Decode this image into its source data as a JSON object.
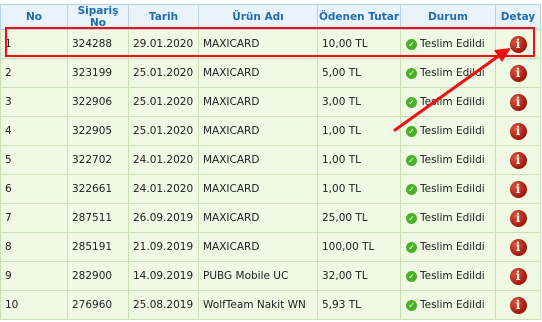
{
  "table": {
    "headers": [
      "No",
      "Sipariş No",
      "Tarih",
      "Ürün Adı",
      "Ödenen Tutar",
      "Durum",
      "Detay"
    ],
    "rows": [
      {
        "no": "1",
        "order": "324288",
        "date": "29.01.2020",
        "product": "MAXICARD",
        "amount": "10,00 TL",
        "status": "Teslim Edildi"
      },
      {
        "no": "2",
        "order": "323199",
        "date": "25.01.2020",
        "product": "MAXICARD",
        "amount": "5,00 TL",
        "status": "Teslim Edildi"
      },
      {
        "no": "3",
        "order": "322906",
        "date": "25.01.2020",
        "product": "MAXICARD",
        "amount": "3,00 TL",
        "status": "Teslim Edildi"
      },
      {
        "no": "4",
        "order": "322905",
        "date": "25.01.2020",
        "product": "MAXICARD",
        "amount": "1,00 TL",
        "status": "Teslim Edildi"
      },
      {
        "no": "5",
        "order": "322702",
        "date": "24.01.2020",
        "product": "MAXICARD",
        "amount": "1,00 TL",
        "status": "Teslim Edildi"
      },
      {
        "no": "6",
        "order": "322661",
        "date": "24.01.2020",
        "product": "MAXICARD",
        "amount": "1,00 TL",
        "status": "Teslim Edildi"
      },
      {
        "no": "7",
        "order": "287511",
        "date": "26.09.2019",
        "product": "MAXICARD",
        "amount": "25,00 TL",
        "status": "Teslim Edildi"
      },
      {
        "no": "8",
        "order": "285191",
        "date": "21.09.2019",
        "product": "MAXICARD",
        "amount": "100,00 TL",
        "status": "Teslim Edildi"
      },
      {
        "no": "9",
        "order": "282900",
        "date": "14.09.2019",
        "product": "PUBG Mobile UC",
        "amount": "32,00 TL",
        "status": "Teslim Edildi"
      },
      {
        "no": "10",
        "order": "276960",
        "date": "25.08.2019",
        "product": "WolfTeam Nakit WN",
        "amount": "5,93 TL",
        "status": "Teslim Edildi"
      }
    ]
  },
  "icons": {
    "status": "check-circle-icon",
    "detail": "info-icon"
  },
  "colors": {
    "header_text": "#1f6cb0",
    "header_bg": "#e9f3fb",
    "row_bg": "#eff9e4",
    "status_check": "#4caf28",
    "detail_icon": "#b3190b",
    "annotation": "#ee1010"
  }
}
